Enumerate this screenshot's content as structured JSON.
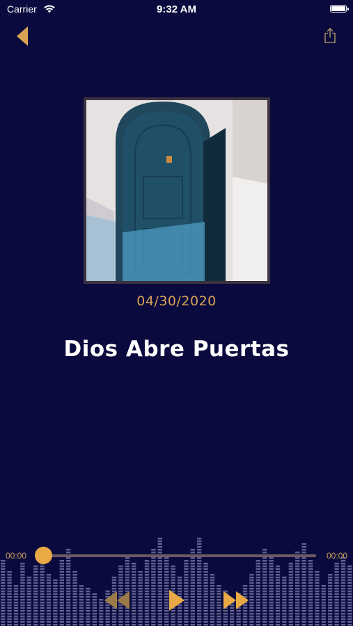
{
  "status_bar": {
    "carrier": "Carrier",
    "time": "9:32 AM"
  },
  "nav": {
    "back_icon": "back-triangle-icon",
    "share_icon": "share-icon"
  },
  "episode": {
    "date": "04/30/2020",
    "title": "Dios Abre Puertas",
    "artwork": "arched-blue-door-image"
  },
  "player": {
    "elapsed": "00:00",
    "duration": "00:00",
    "progress": 0.03,
    "controls": [
      "rewind-icon",
      "play-icon",
      "fast-forward-icon"
    ]
  },
  "colors": {
    "background": "#0a0a3e",
    "accent": "#e9aa45",
    "date_text": "#d9a352",
    "eq_bars": "#7b7ca8"
  }
}
